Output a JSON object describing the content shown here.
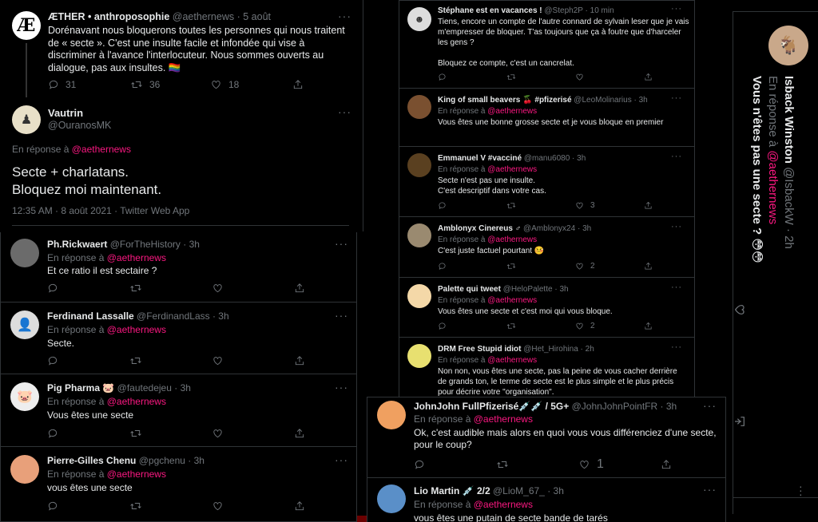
{
  "main": {
    "top": {
      "name": "ÆTHER • anthroposophie",
      "handle": "@aethernews",
      "date": "5 août",
      "flag": "🏳️‍🌈",
      "text": "Dorénavant nous bloquerons toutes les personnes qui nous traitent de « secte ». C'est une insulte facile et infondée qui vise à discriminer à l'avance l'interlocuteur. Nous sommes ouverts au dialogue, pas aux insultes. 🏳️‍🌈",
      "replies": "31",
      "retweets": "36",
      "likes": "18"
    },
    "focus": {
      "name": "Vautrin",
      "handle": "@OuranosMK",
      "reply_to_label": "En réponse à",
      "reply_to": "@aethernews",
      "text": "Secte + charlatans.\nBloquez moi maintenant.",
      "meta": "12:35 AM · 8 août 2021 · Twitter Web App"
    },
    "replies": [
      {
        "name": "Ph.Rickwaert",
        "handle": "@ForTheHistory",
        "time": "3h",
        "text": "Et ce ratio il est sectaire ?"
      },
      {
        "name": "Ferdinand Lassalle",
        "handle": "@FerdinandLass",
        "time": "3h",
        "text": "Secte."
      },
      {
        "name": "Pig Pharma 🐷",
        "handle": "@fautedejeu",
        "time": "3h",
        "text": "Vous êtes une secte"
      },
      {
        "name": "Pierre-Gilles Chenu",
        "handle": "@pgchenu",
        "time": "3h",
        "text": "vous êtes une secte"
      }
    ]
  },
  "middle": [
    {
      "name": "Stéphane est en vacances !",
      "handle": "@Steph2P",
      "time": "10 min",
      "reply": "",
      "text": "Tiens, encore un compte de l'autre connard de sylvain leser que je vais m'empresser de bloquer. T'as toujours que ça à foutre que d'harceler les gens ?\n\nBloquez ce compte, c'est un cancrelat.",
      "retweets": "",
      "likes": ""
    },
    {
      "name": "King of small beavers 🍒 #pfizerisé",
      "handle": "@LeoMolinarius",
      "time": "3h",
      "reply": "@aethernews",
      "text": "Vous êtes une bonne grosse secte et je vous bloque en premier",
      "retweets": "",
      "likes": ""
    },
    {
      "name": "Emmanuel V #vacciné",
      "handle": "@manu6080",
      "time": "3h",
      "reply": "@aethernews",
      "text": "Secte n'est pas une insulte.\nC'est descriptif dans votre cas.",
      "retweets": "",
      "likes": "3"
    },
    {
      "name": "Amblonyx Cinereus ♂",
      "handle": "@Amblonyx24",
      "time": "3h",
      "reply": "@aethernews",
      "text": "C'est juste factuel pourtant 🤒",
      "retweets": "",
      "likes": "2"
    },
    {
      "name": "Palette qui tweet",
      "handle": "@HeloPalette",
      "time": "3h",
      "reply": "@aethernews",
      "text": "Vous êtes une secte et c'est moi qui vous bloque.",
      "retweets": "",
      "likes": "2"
    },
    {
      "name": "DRM Free Stupid idiot",
      "handle": "@Het_Hirohina",
      "time": "2h",
      "reply": "@aethernews",
      "text": "Non non, vous êtes une secte, pas la peine de vous cacher derrière de grands ton, le terme de secte est le plus simple et le plus précis pour décrire votre \"organisation\".",
      "retweets": "",
      "likes": ""
    }
  ],
  "reply_label": "En réponse à",
  "bottom": [
    {
      "name": "JohnJohn FullPfizerisé💉💉 / 5G+",
      "handle": "@JohnJohnPointFR",
      "time": "3h",
      "reply": "@aethernews",
      "text": "Ok, c'est audible mais alors en quoi vous vous différenciez d'une secte, pour le coup?",
      "likes": "1"
    },
    {
      "name": "Lio Martin 💉 2/2",
      "handle": "@LioM_67_",
      "time": "3h",
      "reply": "@aethernews",
      "text": "vous êtes une putain de secte bande de tarés",
      "likes": ""
    }
  ],
  "right": {
    "name": "Isback Winston",
    "handle": "@IsbackW",
    "time": "2h",
    "reply_label": "En réponse à",
    "reply": "@aethernews",
    "text": "Vous n'êtes pas une secte ? 😳😳"
  },
  "colors": {
    "bg": "#000000",
    "text": "#e7e9ea",
    "muted": "#71767b",
    "mention": "#f91880",
    "border": "#2f3336"
  }
}
